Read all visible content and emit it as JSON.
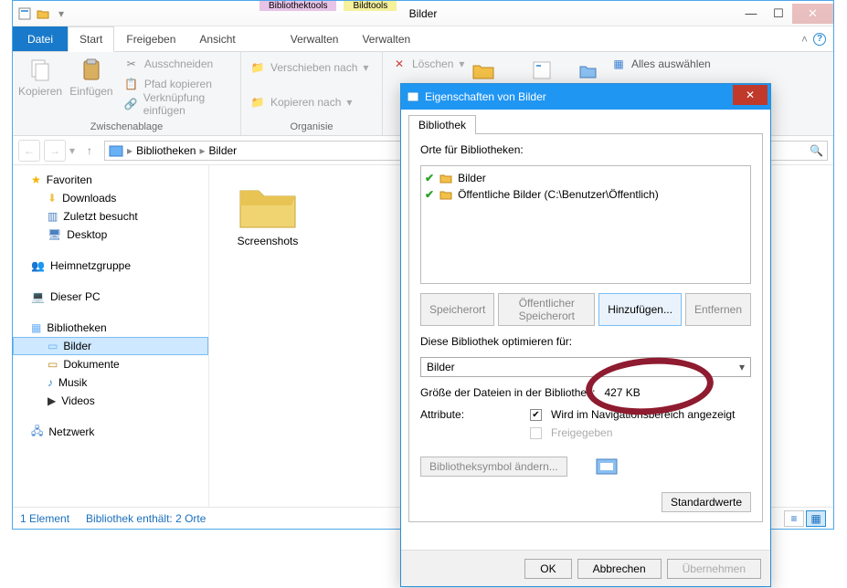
{
  "window": {
    "title": "Bilder",
    "context1_label": "Bibliothektools",
    "context2_label": "Bildtools"
  },
  "ribbon": {
    "file": "Datei",
    "tabs": [
      "Start",
      "Freigeben",
      "Ansicht"
    ],
    "context_tabs": [
      "Verwalten",
      "Verwalten"
    ],
    "copy": "Kopieren",
    "paste": "Einfügen",
    "cut": "Ausschneiden",
    "copypath": "Pfad kopieren",
    "pastelink": "Verknüpfung einfügen",
    "clipboard_label": "Zwischenablage",
    "moveto": "Verschieben nach",
    "copyto": "Kopieren nach",
    "organize_label": "Organisie",
    "delete": "Löschen",
    "selectall": "Alles auswählen"
  },
  "nav": {
    "breadcrumbs": [
      "Bibliotheken",
      "Bilder"
    ],
    "search_placeholder": ""
  },
  "tree": {
    "favorites": "Favoriten",
    "downloads": "Downloads",
    "recent": "Zuletzt besucht",
    "desktop": "Desktop",
    "homegroup": "Heimnetzgruppe",
    "thispc": "Dieser PC",
    "libraries": "Bibliotheken",
    "pictures": "Bilder",
    "documents": "Dokumente",
    "music": "Musik",
    "videos": "Videos",
    "network": "Netzwerk"
  },
  "content": {
    "folder1": "Screenshots"
  },
  "status": {
    "count": "1 Element",
    "lib": "Bibliothek enthält: 2 Orte"
  },
  "dialog": {
    "title": "Eigenschaften von Bilder",
    "tab": "Bibliothek",
    "locations_label": "Orte für Bibliotheken:",
    "loc1": "Bilder",
    "loc2": "Öffentliche Bilder (C:\\Benutzer\\Öffentlich)",
    "btns": {
      "saveloc": "Speicherort",
      "publoc": "Öffentlicher Speicherort",
      "add": "Hinzufügen...",
      "remove": "Entfernen"
    },
    "optimize_label": "Diese Bibliothek optimieren für:",
    "optimize_value": "Bilder",
    "size_label": "Größe der Dateien in der Bibliothek:",
    "size_value": "427 KB",
    "attr_label": "Attribute:",
    "attr_navpane": "Wird im Navigationsbereich angezeigt",
    "attr_shared": "Freigegeben",
    "changeicon": "Bibliotheksymbol ändern...",
    "defaults": "Standardwerte",
    "ok": "OK",
    "cancel": "Abbrechen",
    "apply": "Übernehmen"
  }
}
